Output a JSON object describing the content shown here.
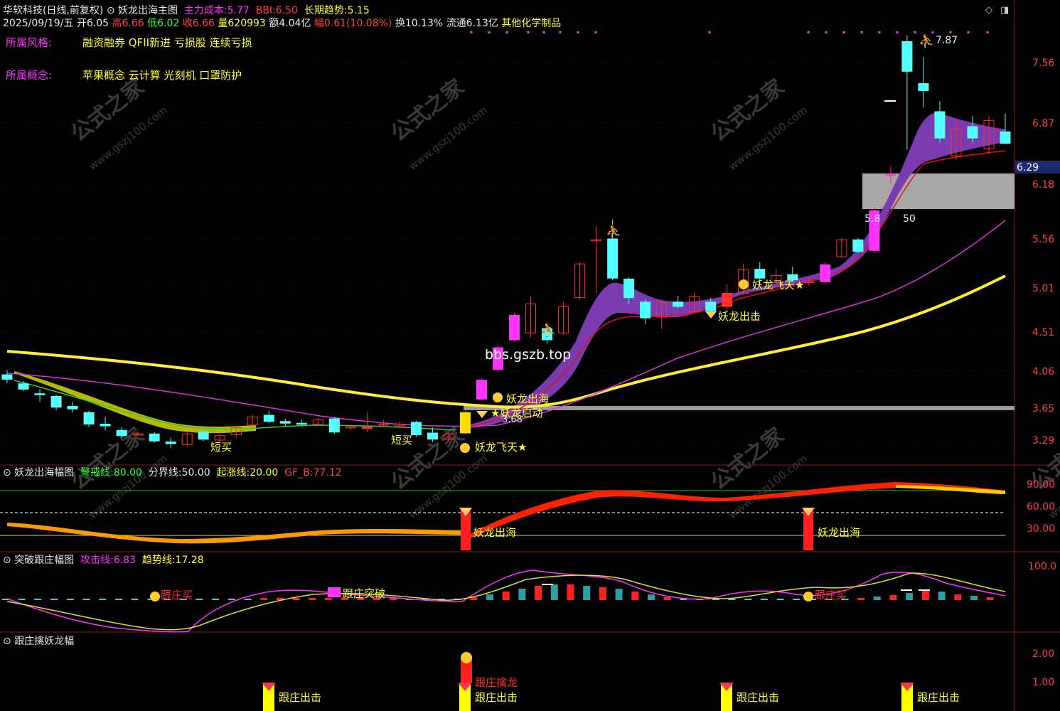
{
  "header": {
    "stock_name": "华软科技(日线,前复权)",
    "indicator_name": "妖龙出海主图",
    "main_cost_label": "主力成本:",
    "main_cost_value": "5.77",
    "bbi_label": "BBI:",
    "bbi_value": "6.50",
    "long_trend_label": "长期趋势:",
    "long_trend_value": "5.15",
    "date": "2025/09/19/五",
    "open": "开6.05",
    "high": "高6.66",
    "low": "低6.02",
    "close": "收6.66",
    "volume": "量620993",
    "amount": "额4.04亿",
    "change": "幅0.61(10.08%)",
    "turnover": "换10.13%",
    "float_cap": "流通6.13亿",
    "industry": "其他化学制品"
  },
  "info": {
    "style_label": "所属风格:",
    "style_value": "融资融券 QFII新进 亏损股 连续亏损",
    "concept_label": "所属概念:",
    "concept_value": "苹果概念 云计算 光刻机 口罩防护"
  },
  "price_axis": [
    "7.56",
    "6.87",
    "6.18",
    "5.56",
    "5.01",
    "4.51",
    "4.06",
    "3.65",
    "3.29"
  ],
  "current_price_tag": "6.29",
  "annotations": {
    "high_mark": "7.87",
    "label_5_8": "5.8",
    "label_50": "50",
    "label_3_68": "3.68",
    "short_buy_1": "短买",
    "short_buy_2": "短买",
    "yao_chuhai": "妖龙出海",
    "yao_qidong": "★妖龙启动",
    "yao_feitian_1": "妖龙飞天★",
    "yao_chuji": "妖龙出击",
    "yao_feitian_2": "妖龙飞天★",
    "watermark_site": "bbs.gszb.top",
    "watermark_text": "公式之家",
    "watermark_url": "www.gszj100.com"
  },
  "panel1": {
    "title": "妖龙出海幅图",
    "warn_label": "警戒线:",
    "warn_value": "80.00",
    "divide_label": "分界线:",
    "divide_value": "50.00",
    "rise_label": "起涨线:",
    "rise_value": "20.00",
    "gfb_label": "GF_B:",
    "gfb_value": "77.12",
    "axis": [
      "90.00",
      "60.00",
      "30.00"
    ],
    "signal_1": "妖龙出海",
    "signal_2": "妖龙出海"
  },
  "panel2": {
    "title": "突破跟庄幅图",
    "attack_label": "攻击线:",
    "attack_value": "6.83",
    "trend_label": "趋势线:",
    "trend_value": "17.28",
    "axis": [
      "100.0"
    ],
    "signal_buy_1": "跟庄买",
    "signal_break": "跟庄突破",
    "signal_buy_2": "跟庄买"
  },
  "panel3": {
    "title": "跟庄擒妖龙幅",
    "axis": [
      "2.00",
      "1.00"
    ],
    "signal_catch": "跟庄擒龙",
    "exit_1": "跟庄出击",
    "exit_2": "跟庄出击",
    "exit_3": "跟庄出击",
    "exit_4": "跟庄出击"
  },
  "chart_data": {
    "type": "candlestick",
    "price_ylim": [
      3.1,
      7.9
    ],
    "candles": [
      {
        "o": 4.02,
        "h": 4.07,
        "l": 3.93,
        "c": 3.97
      },
      {
        "o": 3.92,
        "h": 3.95,
        "l": 3.84,
        "c": 3.86
      },
      {
        "o": 3.81,
        "h": 3.86,
        "l": 3.72,
        "c": 3.8
      },
      {
        "o": 3.78,
        "h": 3.8,
        "l": 3.63,
        "c": 3.66
      },
      {
        "o": 3.67,
        "h": 3.72,
        "l": 3.6,
        "c": 3.64
      },
      {
        "o": 3.6,
        "h": 3.62,
        "l": 3.44,
        "c": 3.47
      },
      {
        "o": 3.47,
        "h": 3.55,
        "l": 3.4,
        "c": 3.45
      },
      {
        "o": 3.4,
        "h": 3.44,
        "l": 3.32,
        "c": 3.34
      },
      {
        "o": 3.36,
        "h": 3.39,
        "l": 3.34,
        "c": 3.36
      },
      {
        "o": 3.36,
        "h": 3.38,
        "l": 3.26,
        "c": 3.28
      },
      {
        "o": 3.27,
        "h": 3.32,
        "l": 3.2,
        "c": 3.25
      },
      {
        "o": 3.24,
        "h": 3.38,
        "l": 3.22,
        "c": 3.36
      },
      {
        "o": 3.38,
        "h": 3.4,
        "l": 3.28,
        "c": 3.3
      },
      {
        "o": 3.29,
        "h": 3.36,
        "l": 3.27,
        "c": 3.34
      },
      {
        "o": 3.35,
        "h": 3.45,
        "l": 3.32,
        "c": 3.43
      },
      {
        "o": 3.46,
        "h": 3.58,
        "l": 3.45,
        "c": 3.55
      },
      {
        "o": 3.57,
        "h": 3.62,
        "l": 3.48,
        "c": 3.5
      },
      {
        "o": 3.5,
        "h": 3.53,
        "l": 3.45,
        "c": 3.48
      },
      {
        "o": 3.48,
        "h": 3.52,
        "l": 3.45,
        "c": 3.47
      },
      {
        "o": 3.47,
        "h": 3.54,
        "l": 3.45,
        "c": 3.52
      },
      {
        "o": 3.53,
        "h": 3.55,
        "l": 3.36,
        "c": 3.38
      },
      {
        "o": 3.43,
        "h": 3.46,
        "l": 3.4,
        "c": 3.44
      },
      {
        "o": 3.42,
        "h": 3.61,
        "l": 3.38,
        "c": 3.44
      },
      {
        "o": 3.46,
        "h": 3.52,
        "l": 3.44,
        "c": 3.47
      },
      {
        "o": 3.45,
        "h": 3.5,
        "l": 3.42,
        "c": 3.47
      },
      {
        "o": 3.49,
        "h": 3.51,
        "l": 3.33,
        "c": 3.35
      },
      {
        "o": 3.37,
        "h": 3.43,
        "l": 3.27,
        "c": 3.3
      },
      {
        "o": 3.3,
        "h": 3.38,
        "l": 3.27,
        "c": 3.36
      },
      {
        "o": 3.37,
        "h": 3.62,
        "l": 3.36,
        "c": 3.6
      },
      {
        "o": 3.75,
        "h": 3.98,
        "l": 3.73,
        "c": 3.96
      },
      {
        "o": 4.08,
        "h": 4.36,
        "l": 4.05,
        "c": 4.33
      },
      {
        "o": 4.42,
        "h": 4.73,
        "l": 4.4,
        "c": 4.7
      },
      {
        "o": 4.5,
        "h": 4.91,
        "l": 4.45,
        "c": 4.83
      },
      {
        "o": 4.55,
        "h": 4.6,
        "l": 4.38,
        "c": 4.42
      },
      {
        "o": 4.5,
        "h": 4.85,
        "l": 4.48,
        "c": 4.8
      },
      {
        "o": 4.9,
        "h": 5.3,
        "l": 4.88,
        "c": 5.28
      },
      {
        "o": 5.55,
        "h": 5.7,
        "l": 4.95,
        "c": 5.55
      },
      {
        "o": 5.56,
        "h": 5.78,
        "l": 5.1,
        "c": 5.12
      },
      {
        "o": 5.11,
        "h": 5.13,
        "l": 4.83,
        "c": 4.9
      },
      {
        "o": 4.85,
        "h": 4.88,
        "l": 4.6,
        "c": 4.67
      },
      {
        "o": 4.68,
        "h": 4.88,
        "l": 4.55,
        "c": 4.85
      },
      {
        "o": 4.85,
        "h": 4.92,
        "l": 4.78,
        "c": 4.8
      },
      {
        "o": 4.74,
        "h": 4.96,
        "l": 4.72,
        "c": 4.91
      },
      {
        "o": 4.85,
        "h": 4.9,
        "l": 4.68,
        "c": 4.75
      },
      {
        "o": 4.8,
        "h": 5.05,
        "l": 4.75,
        "c": 4.95
      },
      {
        "o": 4.95,
        "h": 5.28,
        "l": 4.93,
        "c": 5.22
      },
      {
        "o": 5.22,
        "h": 5.3,
        "l": 5.05,
        "c": 5.12
      },
      {
        "o": 5.07,
        "h": 5.22,
        "l": 5.05,
        "c": 5.15
      },
      {
        "o": 5.16,
        "h": 5.25,
        "l": 5.08,
        "c": 5.1
      },
      {
        "o": 5.07,
        "h": 5.13,
        "l": 5.03,
        "c": 5.08
      },
      {
        "o": 5.08,
        "h": 5.3,
        "l": 5.06,
        "c": 5.27
      },
      {
        "o": 5.36,
        "h": 5.57,
        "l": 5.35,
        "c": 5.55
      },
      {
        "o": 5.55,
        "h": 5.57,
        "l": 5.4,
        "c": 5.42
      },
      {
        "o": 5.43,
        "h": 5.92,
        "l": 5.4,
        "c": 5.88
      },
      {
        "o": 6.28,
        "h": 6.38,
        "l": 6.18,
        "c": 6.29
      },
      {
        "o": 7.8,
        "h": 7.87,
        "l": 6.57,
        "c": 7.46
      },
      {
        "o": 7.32,
        "h": 7.62,
        "l": 7.05,
        "c": 7.24
      },
      {
        "o": 7.0,
        "h": 7.12,
        "l": 6.65,
        "c": 6.7
      },
      {
        "o": 6.5,
        "h": 6.9,
        "l": 6.45,
        "c": 6.8
      },
      {
        "o": 6.83,
        "h": 6.95,
        "l": 6.65,
        "c": 6.7
      },
      {
        "o": 6.58,
        "h": 6.95,
        "l": 6.52,
        "c": 6.9
      },
      {
        "o": 6.77,
        "h": 6.98,
        "l": 6.68,
        "c": 6.64
      }
    ]
  }
}
